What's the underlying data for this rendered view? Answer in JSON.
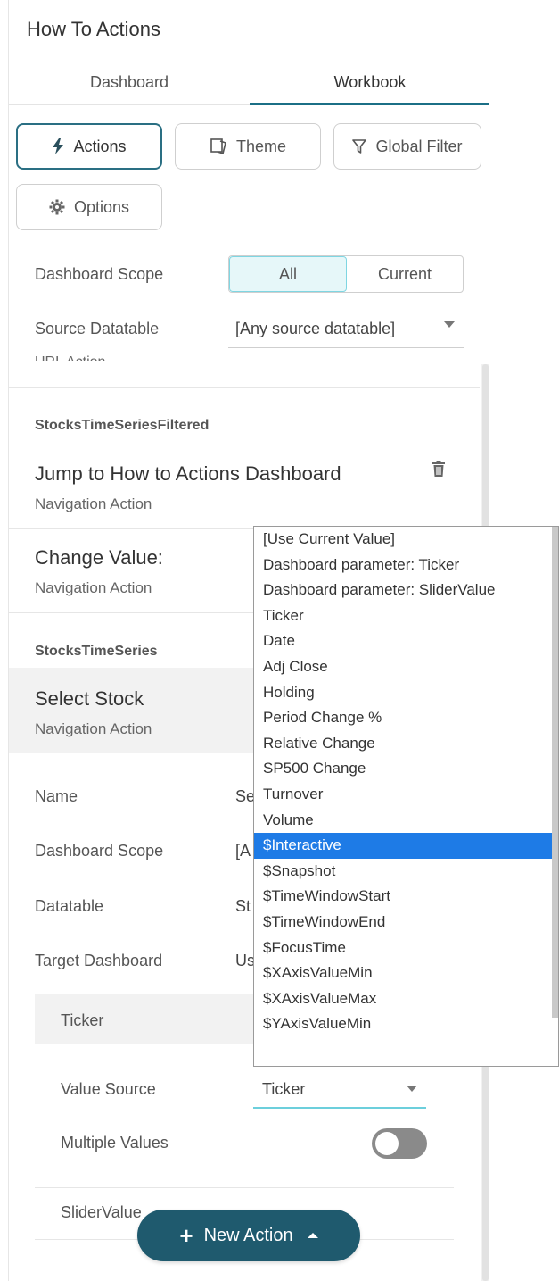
{
  "panel": {
    "title": "How To Actions"
  },
  "tabs": [
    {
      "label": "Dashboard"
    },
    {
      "label": "Workbook",
      "active": true
    }
  ],
  "toolbar": {
    "actions_label": "Actions",
    "theme_label": "Theme",
    "global_filter_label": "Global Filter",
    "options_label": "Options"
  },
  "scope": {
    "label": "Dashboard Scope",
    "options": [
      "All",
      "Current"
    ],
    "selected": "All"
  },
  "source": {
    "label": "Source Datatable",
    "value": "[Any source datatable]"
  },
  "cut_text": "URL Action",
  "groups": [
    {
      "name": "StocksTimeSeriesFiltered",
      "actions": [
        {
          "title": "Jump to How to Actions Dashboard",
          "type": "Navigation Action"
        },
        {
          "title": "Change Value:",
          "type": "Navigation Action"
        }
      ]
    },
    {
      "name": "StocksTimeSeries",
      "actions": [
        {
          "title": "Select Stock",
          "type": "Navigation Action"
        }
      ]
    }
  ],
  "form": {
    "name_label": "Name",
    "name_value": "Se",
    "scope_label": "Dashboard Scope",
    "scope_value": "[A",
    "datatable_label": "Datatable",
    "datatable_value": "St",
    "target_label": "Target Dashboard",
    "target_value": "Us",
    "param_name": "Ticker",
    "value_source_label": "Value Source",
    "value_source_value": "Ticker",
    "multiple_label": "Multiple Values",
    "multiple_on": false,
    "next_param": "SliderValue"
  },
  "new_action": {
    "label": "New Action"
  },
  "dropdown": {
    "options": [
      "[Use Current Value]",
      "Dashboard parameter: Ticker",
      "Dashboard parameter: SliderValue",
      "Ticker",
      "Date",
      "Adj Close",
      "Holding",
      "Period Change %",
      "Relative Change",
      "SP500 Change",
      "Turnover",
      "Volume",
      "$Interactive",
      "$Snapshot",
      "$TimeWindowStart",
      "$TimeWindowEnd",
      "$FocusTime",
      "$XAxisValueMin",
      "$XAxisValueMax",
      "$YAxisValueMin"
    ],
    "highlighted": "$Interactive"
  },
  "colors": {
    "accent": "#1b6f86",
    "fab": "#1f5a6e",
    "highlight": "#1e7be6",
    "segment_active_bg": "#e6f7f9"
  }
}
